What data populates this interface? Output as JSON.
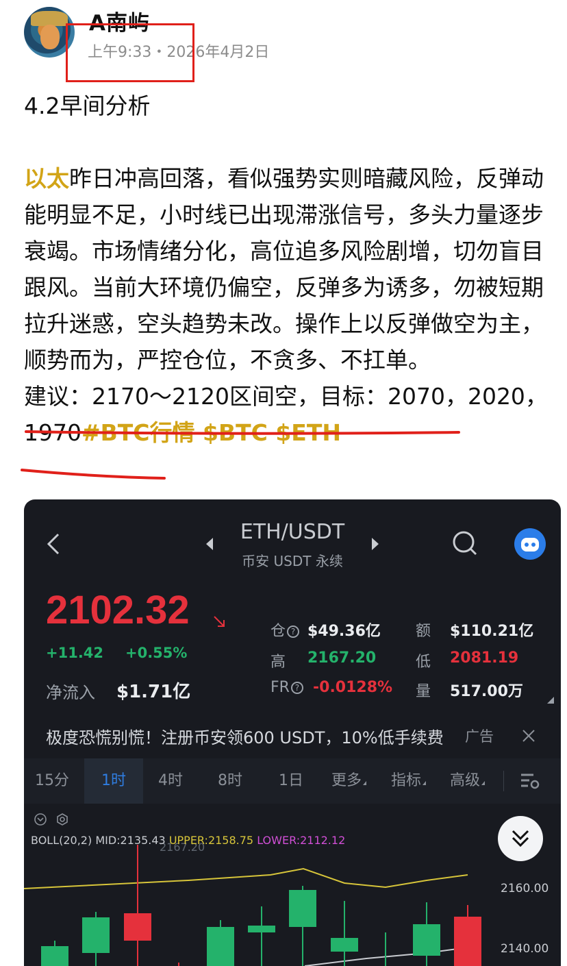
{
  "post": {
    "username": "A南屿",
    "time": "上午9:33・2026年4月2日",
    "title": "4.2早间分析",
    "highlight": "以太",
    "body": "昨日冲高回落，看似强势实则暗藏风险，反弹动能明显不足，小时线已出现滞涨信号，多头力量逐步衰竭。市场情绪分化，高位追多风险剧增，切勿盲目跟风。当前大环境仍偏空，反弹多为诱多，勿被短期拉升迷惑，空头趋势未改。操作上以反弹做空为主，顺势而为，严控仓位，不贪多、不扛单。",
    "suggestion": "建议：2170～2120区间空，目标：2070，2020，1970",
    "tags": "#BTC行情 $BTC $ETH",
    "accent_color": "#d2a417"
  },
  "chart_card": {
    "pair": "ETH/USDT",
    "market": "币安 USDT 永续",
    "price": "2102.32",
    "change_abs": "+11.42",
    "change_pct": "+0.55%",
    "netflow_label": "净流入",
    "netflow_value": "$1.71亿",
    "stats": {
      "oi_label": "仓",
      "oi_value": "$49.36亿",
      "amount_label": "额",
      "amount_value": "$110.21亿",
      "high_label": "高",
      "high_value": "2167.20",
      "low_label": "低",
      "low_value": "2081.19",
      "fr_label": "FR",
      "fr_value": "-0.0128%",
      "vol_label": "量",
      "vol_value": "517.00万"
    },
    "ad_text": "极度恐慌别慌！注册币安领600 USDT，10%低手续费",
    "ad_tag": "广告",
    "tabs": [
      "15分",
      "1时",
      "4时",
      "8时",
      "1日",
      "更多",
      "指标",
      "高级"
    ],
    "active_tab": "1时",
    "boll_base": "BOLL(20,2) MID:2135.43",
    "boll_upper": "UPPER:2158.75",
    "boll_lower": "LOWER:2112.12",
    "faded_label": "2167.20",
    "y_labels": [
      "2160.00",
      "2140.00"
    ],
    "colors": {
      "up": "#24b26b",
      "down": "#e5313c",
      "background": "#181a20",
      "upper_band": "#d7c53a",
      "lower_band": "#d14fd6"
    }
  }
}
